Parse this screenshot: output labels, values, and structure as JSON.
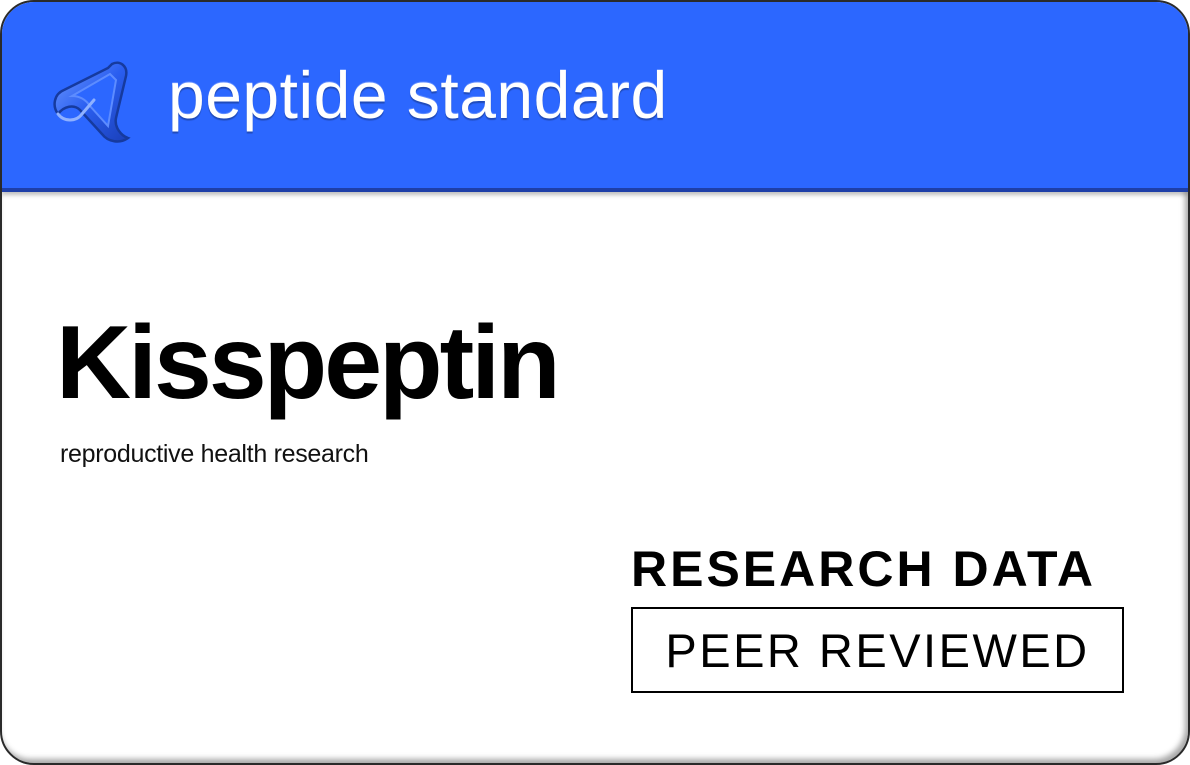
{
  "header": {
    "brand": "peptide standard",
    "logo_icon": "triangular-loop-logo-icon",
    "color": "#2c67ff"
  },
  "main": {
    "title": "Kisspeptin",
    "subtitle": "reproductive health research"
  },
  "badges": {
    "research_label": "RESEARCH DATA",
    "peer_label": "PEER REVIEWED"
  }
}
